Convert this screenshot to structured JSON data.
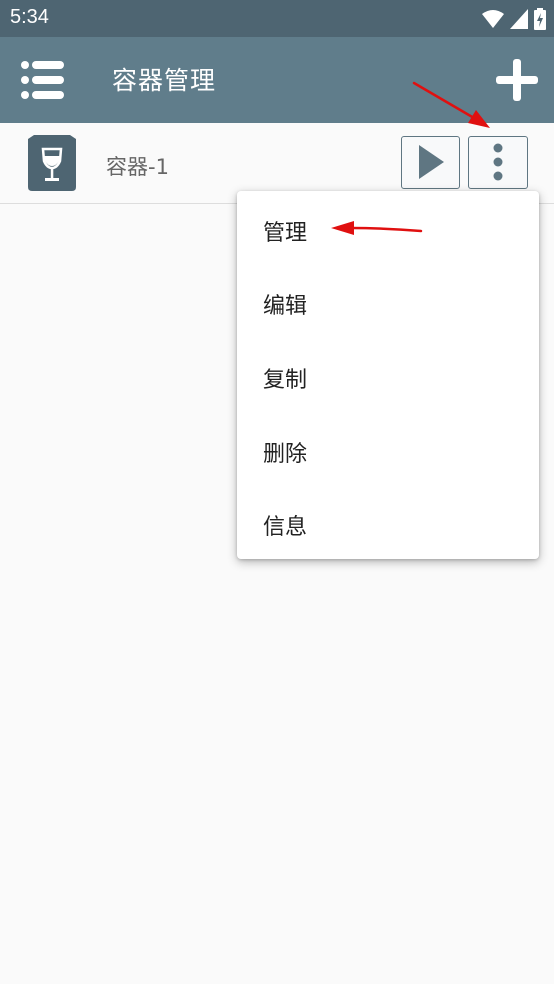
{
  "status_bar": {
    "time": "5:34",
    "icons": [
      "wifi-icon",
      "cell-signal-icon",
      "battery-charging-icon"
    ]
  },
  "app_bar": {
    "menu_icon": "list-menu-icon",
    "title": "容器管理",
    "add_icon": "plus-icon"
  },
  "containers": [
    {
      "name": "容器-1",
      "icon": "wine-glass-box-icon",
      "play_icon": "play-icon",
      "more_icon": "more-vertical-icon"
    }
  ],
  "popup_menu": {
    "items": [
      "管理",
      "编辑",
      "复制",
      "删除",
      "信息"
    ]
  },
  "annotations": [
    "red-arrow-to-more-button",
    "red-arrow-to-manage-item"
  ],
  "colors": {
    "status_bar": "#4e6572",
    "app_bar": "#607d8b",
    "button_accent": "#5f7682",
    "arrow": "#e01010"
  }
}
